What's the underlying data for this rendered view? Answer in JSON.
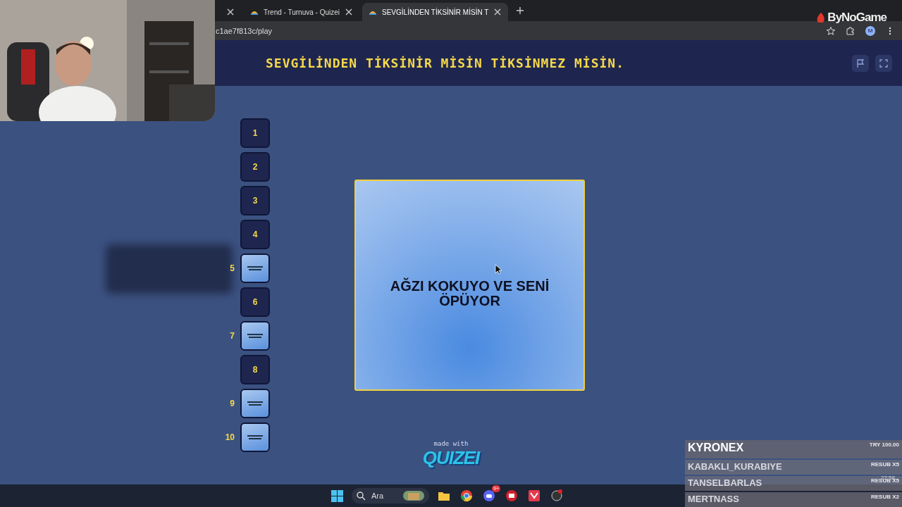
{
  "browser": {
    "tabs": [
      {
        "selected": false
      },
      {
        "title": "Trend - Turnuva - Quizei",
        "selected": false
      },
      {
        "title": "SEVGİLİNDEN TİKSİNİR MİSİN T",
        "selected": true
      }
    ],
    "address": "c1ae7f813c/play",
    "profile": "M"
  },
  "stream_logo": "ByNoGame",
  "quiz": {
    "title": "SEVGİLİNDEN TİKSİNİR MİSİN TİKSİNMEZ MİSİN.",
    "slots": [
      {
        "number": "1",
        "kind": "number"
      },
      {
        "number": "2",
        "kind": "number"
      },
      {
        "number": "3",
        "kind": "number"
      },
      {
        "number": "4",
        "kind": "number"
      },
      {
        "number": "5",
        "kind": "thumb"
      },
      {
        "number": "6",
        "kind": "number"
      },
      {
        "number": "7",
        "kind": "thumb"
      },
      {
        "number": "8",
        "kind": "number"
      },
      {
        "number": "9",
        "kind": "thumb"
      },
      {
        "number": "10",
        "kind": "thumb"
      }
    ],
    "card": {
      "text": "AĞZI KOKUYO VE SENİ ÖPÜYOR"
    },
    "footer": {
      "caption": "made with",
      "brand": "QUIZEI"
    }
  },
  "taskbar": {
    "search": "Ara",
    "discord_badge": "9+"
  },
  "alerts": {
    "top": {
      "name": "KYRONEX",
      "amount": "TRY 100.00"
    },
    "rows": [
      {
        "name": "KABAKLI_KURABIYE",
        "event": "RESUB X5"
      },
      {
        "name": "TANSELBARLAS",
        "event": "RESUB X5"
      },
      {
        "name": "MERTNASS",
        "event": "RESUB X2"
      }
    ],
    "clock": "22:58"
  }
}
